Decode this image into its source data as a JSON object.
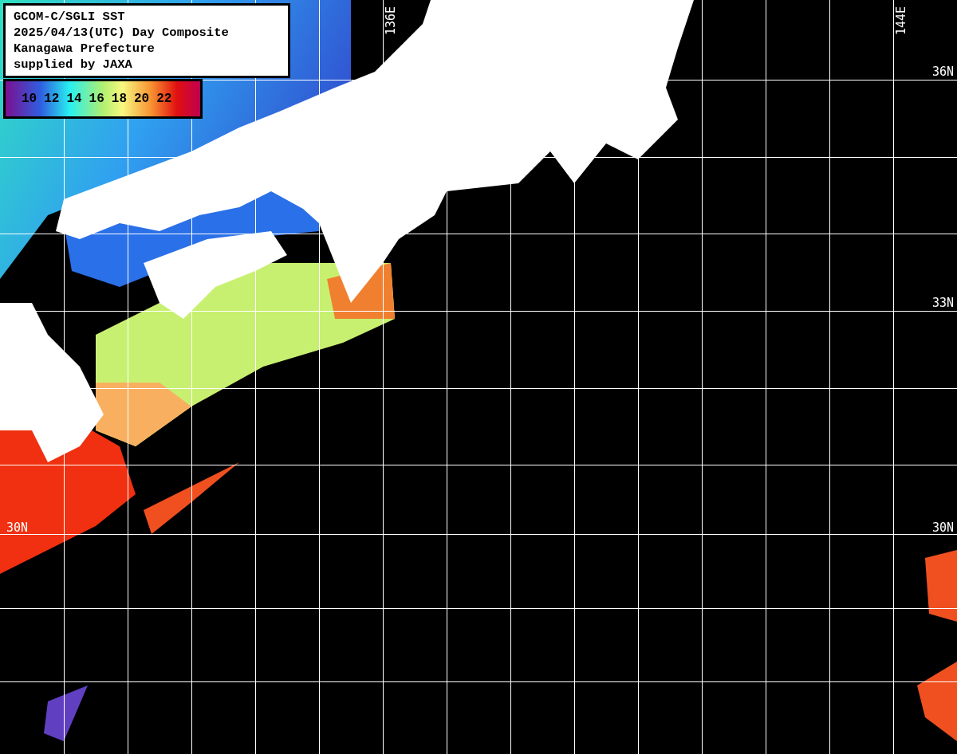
{
  "title_lines": [
    "GCOM-C/SGLI SST",
    "2025/04/13(UTC) Day Composite",
    "Kanagawa Prefecture",
    "supplied by JAXA"
  ],
  "legend": {
    "labels": [
      "10",
      "12",
      "14",
      "16",
      "18",
      "20",
      "22"
    ]
  },
  "map": {
    "longitude_labels": [
      "136E",
      "144E"
    ],
    "latitude_labels_left": [
      "30N"
    ],
    "latitude_labels_right": [
      "36N",
      "33N",
      "30N"
    ]
  }
}
